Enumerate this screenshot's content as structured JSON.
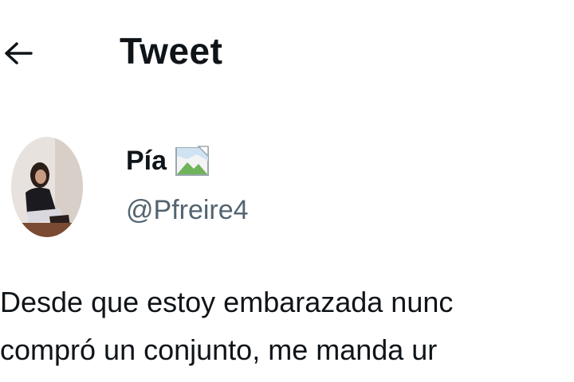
{
  "header": {
    "title": "Tweet",
    "back_icon": "arrow-left-icon"
  },
  "author": {
    "display_name": "Pía",
    "handle": "@Pfreire4",
    "avatar_icon": "user-avatar",
    "badge_icon": "broken-image-icon"
  },
  "tweet": {
    "lines": [
      "Desde que estoy embarazada nunc",
      "compró un conjunto, me manda ur"
    ]
  },
  "colors": {
    "text": "#0f1419",
    "secondary_text": "#536471",
    "background": "#ffffff"
  }
}
